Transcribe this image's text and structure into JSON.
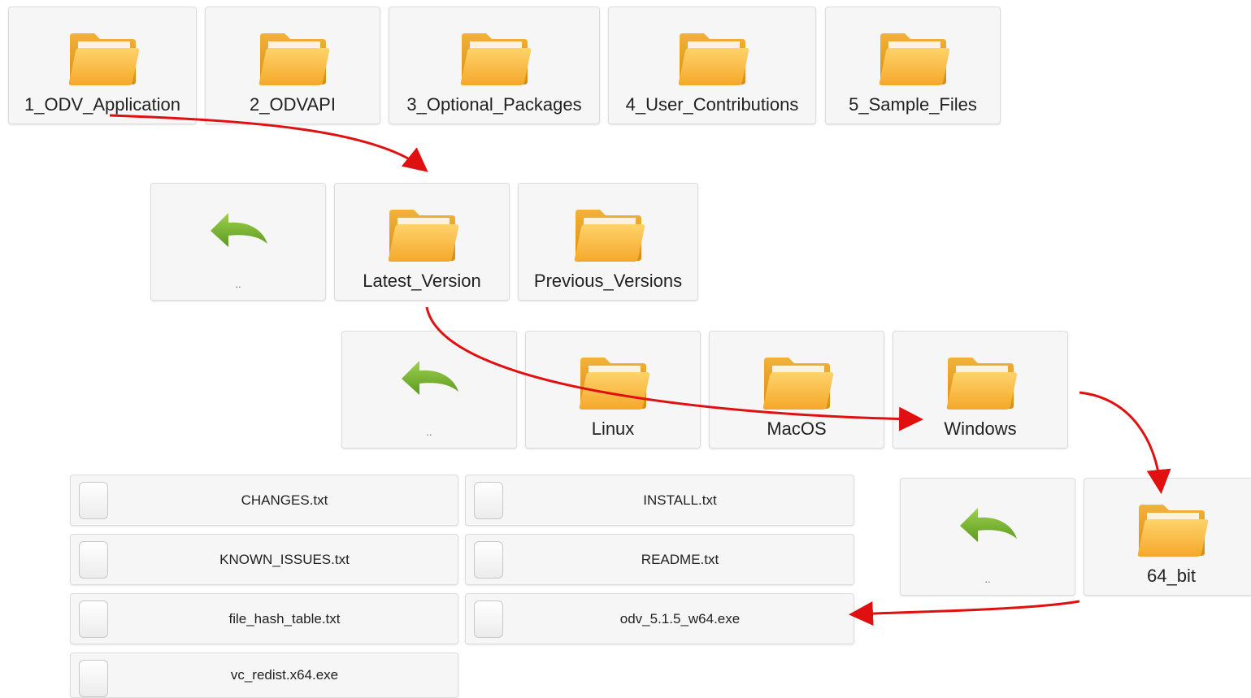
{
  "top_level": {
    "folders": [
      "1_ODV_Application",
      "2_ODVAPI",
      "3_Optional_Packages",
      "4_User_Contributions",
      "5_Sample_Files"
    ]
  },
  "level2": {
    "up_label": "..",
    "folders": [
      "Latest_Version",
      "Previous_Versions"
    ]
  },
  "level3": {
    "up_label": "..",
    "folders": [
      "Linux",
      "MacOS",
      "Windows"
    ]
  },
  "level4": {
    "up_label": "..",
    "folders": [
      "64_bit"
    ]
  },
  "files": [
    "CHANGES.txt",
    "INSTALL.txt",
    "KNOWN_ISSUES.txt",
    "README.txt",
    "file_hash_table.txt",
    "odv_5.1.5_w64.exe",
    "vc_redist.x64.exe"
  ],
  "colors": {
    "arrow": "#e01010",
    "folder_front": "#f7b22f",
    "folder_back": "#e59a18",
    "back_arrow": "#6fae2a"
  },
  "icons": {
    "folder": "folder-icon",
    "up": "back-arrow-icon",
    "file": "file-checkbox-icon"
  }
}
